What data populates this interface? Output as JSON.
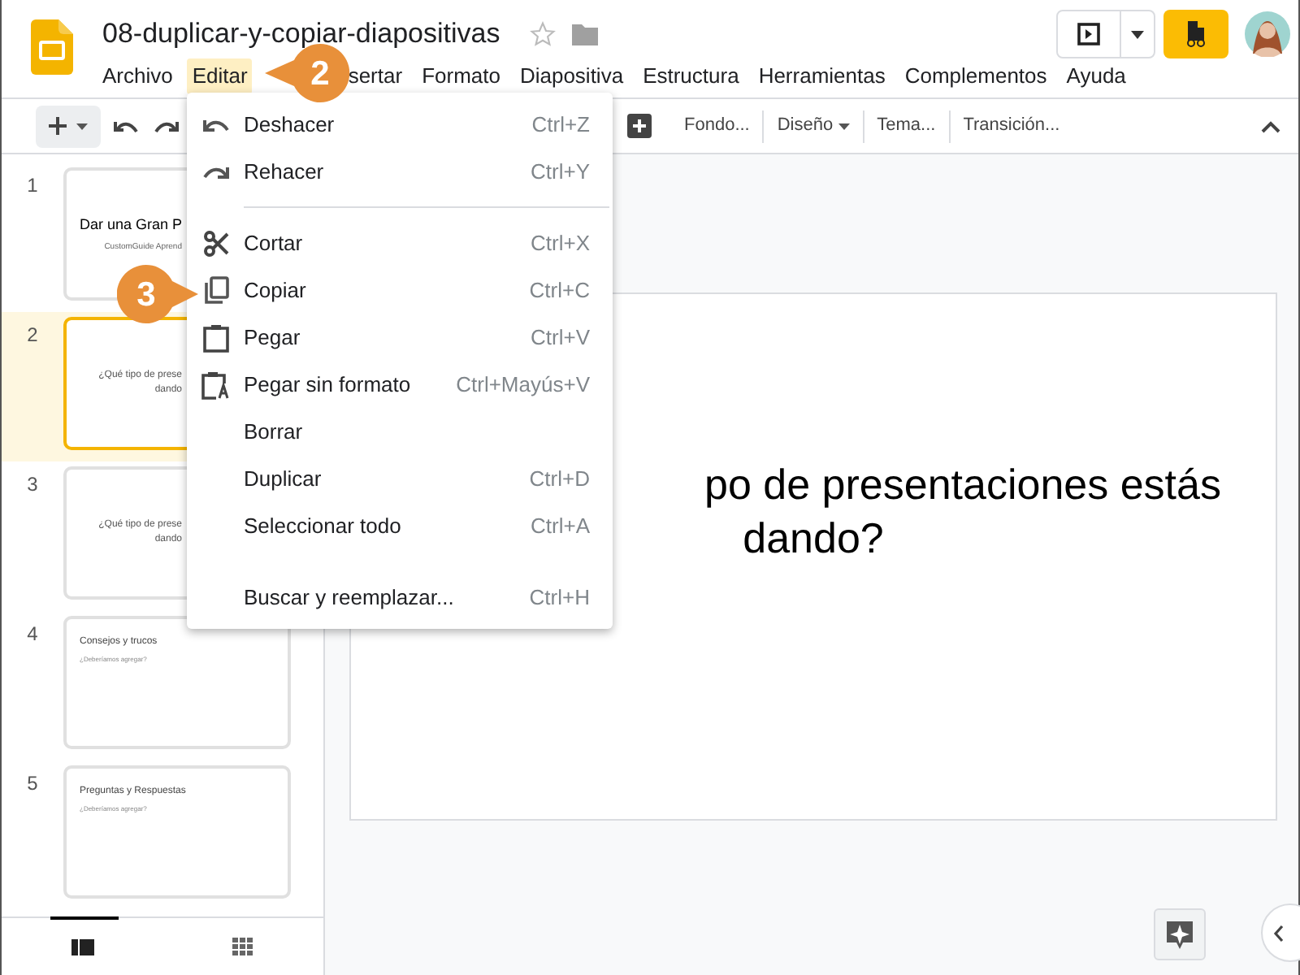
{
  "document": {
    "title": "08-duplicar-y-copiar-diapositivas"
  },
  "menu_bar": [
    {
      "label": "Archivo",
      "selected": false
    },
    {
      "label": "Editar",
      "selected": true
    },
    {
      "label": "sertar",
      "selected": false
    },
    {
      "label": "Formato",
      "selected": false
    },
    {
      "label": "Diapositiva",
      "selected": false
    },
    {
      "label": "Estructura",
      "selected": false
    },
    {
      "label": "Herramientas",
      "selected": false
    },
    {
      "label": "Complementos",
      "selected": false
    },
    {
      "label": "Ayuda",
      "selected": false
    }
  ],
  "toolbar": [
    {
      "label": "Fondo...",
      "dropdown": false
    },
    {
      "label": "Diseño",
      "dropdown": true
    },
    {
      "label": "Tema...",
      "dropdown": false
    },
    {
      "label": "Transición...",
      "dropdown": false
    }
  ],
  "slides": [
    {
      "number": "1",
      "selected": false,
      "kind": "clipped",
      "lines": [
        {
          "kind": "title",
          "text": "Dar una Gran P"
        },
        {
          "kind": "subtitle",
          "text": "CustomGuide Aprend"
        }
      ]
    },
    {
      "number": "2",
      "selected": true,
      "kind": "clipped",
      "lines": [
        {
          "kind": "body",
          "text": "¿Qué tipo de prese"
        },
        {
          "kind": "body",
          "text": "dando"
        }
      ]
    },
    {
      "number": "3",
      "selected": false,
      "kind": "clipped",
      "lines": [
        {
          "kind": "body",
          "text": "¿Qué tipo de prese"
        },
        {
          "kind": "body",
          "text": "dando"
        }
      ]
    },
    {
      "number": "4",
      "selected": false,
      "kind": "heading",
      "lines": [
        {
          "kind": "title",
          "text": "Consejos y trucos"
        },
        {
          "kind": "subtitle",
          "text": "¿Deberíamos agregar?"
        }
      ]
    },
    {
      "number": "5",
      "selected": false,
      "kind": "heading",
      "lines": [
        {
          "kind": "title",
          "text": "Preguntas y Respuestas"
        },
        {
          "kind": "subtitle",
          "text": "¿Deberíamos agregar?"
        }
      ]
    }
  ],
  "slide_text": [
    "po de presentaciones estás",
    "dando?"
  ],
  "edit_menu": [
    {
      "kind": "item",
      "label": "Deshacer",
      "shortcut": "Ctrl+Z"
    },
    {
      "kind": "item",
      "label": "Rehacer",
      "shortcut": "Ctrl+Y"
    },
    {
      "kind": "separator"
    },
    {
      "kind": "item",
      "label": "Cortar",
      "shortcut": "Ctrl+X"
    },
    {
      "kind": "item",
      "label": "Copiar",
      "shortcut": "Ctrl+C"
    },
    {
      "kind": "item",
      "label": "Pegar",
      "shortcut": "Ctrl+V"
    },
    {
      "kind": "item",
      "label": "Pegar sin formato",
      "shortcut": "Ctrl+Mayús+V"
    },
    {
      "kind": "item",
      "label": "Borrar"
    },
    {
      "kind": "item",
      "label": "Duplicar",
      "shortcut": "Ctrl+D"
    },
    {
      "kind": "item",
      "label": "Seleccionar todo",
      "shortcut": "Ctrl+A"
    },
    {
      "kind": "spacer"
    },
    {
      "kind": "item",
      "label": "Buscar y reemplazar...",
      "shortcut": "Ctrl+H"
    }
  ],
  "callouts": [
    "2",
    "3"
  ]
}
